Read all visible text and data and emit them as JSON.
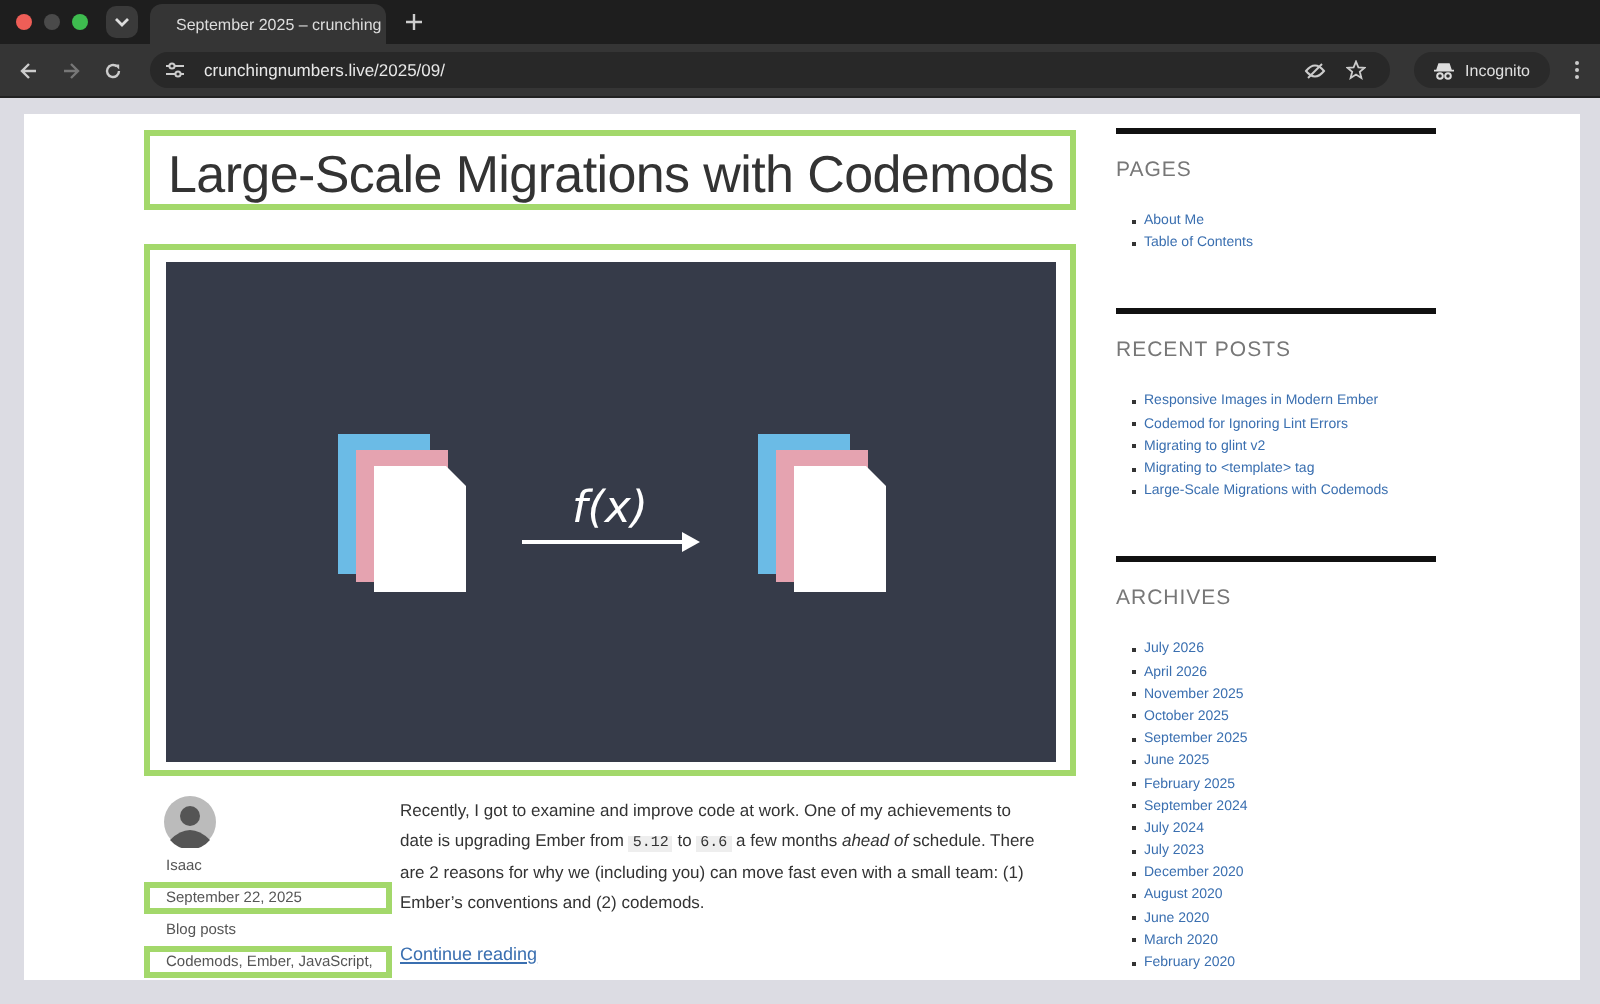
{
  "browser": {
    "tab": {
      "title": "September 2025 – crunching"
    },
    "url": "crunchingnumbers.live/2025/09/",
    "profile": "Incognito"
  },
  "post": {
    "title": {
      "text": "Large-Scale Migrations with Codemods",
      "highlighted": true
    },
    "image": {
      "formula": "f(x)",
      "highlighted": true
    },
    "meta": {
      "author": {
        "text": "Isaac",
        "highlighted": false
      },
      "date": {
        "text": "September 22, 2025",
        "highlighted": true
      },
      "category": {
        "text": "Blog posts",
        "highlighted": false
      },
      "tags": {
        "text": "Codemods, Ember, JavaScript,",
        "highlighted": true
      }
    },
    "excerpt": [
      {
        "kind": "text",
        "text": "Recently, I got to examine and improve code at work. One of my achievements to date is upgrading Ember from "
      },
      {
        "kind": "code",
        "text": "5.12"
      },
      {
        "kind": "text",
        "text": " to "
      },
      {
        "kind": "code",
        "text": "6.6"
      },
      {
        "kind": "text",
        "text": " a few months *ahead of* schedule. There are 2 reasons for why we (including you) can move fast even with a small team: (1) Ember’s conventions and (2) codemods."
      }
    ],
    "more": "Continue reading"
  },
  "sidebar": [
    {
      "heading": "PAGES",
      "items": [
        "About Me",
        "Table of Contents"
      ]
    },
    {
      "heading": "RECENT POSTS",
      "items": [
        "Responsive Images in Modern Ember",
        "Codemod for Ignoring Lint Errors",
        "Migrating to glint v2",
        "Migrating to <template> tag",
        "Large-Scale Migrations with Codemods"
      ]
    },
    {
      "heading": "ARCHIVES",
      "items": [
        "July 2026",
        "April 2026",
        "November 2025",
        "October 2025",
        "September 2025",
        "June 2025",
        "February 2025",
        "September 2024",
        "July 2024",
        "July 2023",
        "December 2020",
        "August 2020",
        "June 2020",
        "March 2020",
        "February 2020"
      ]
    }
  ]
}
